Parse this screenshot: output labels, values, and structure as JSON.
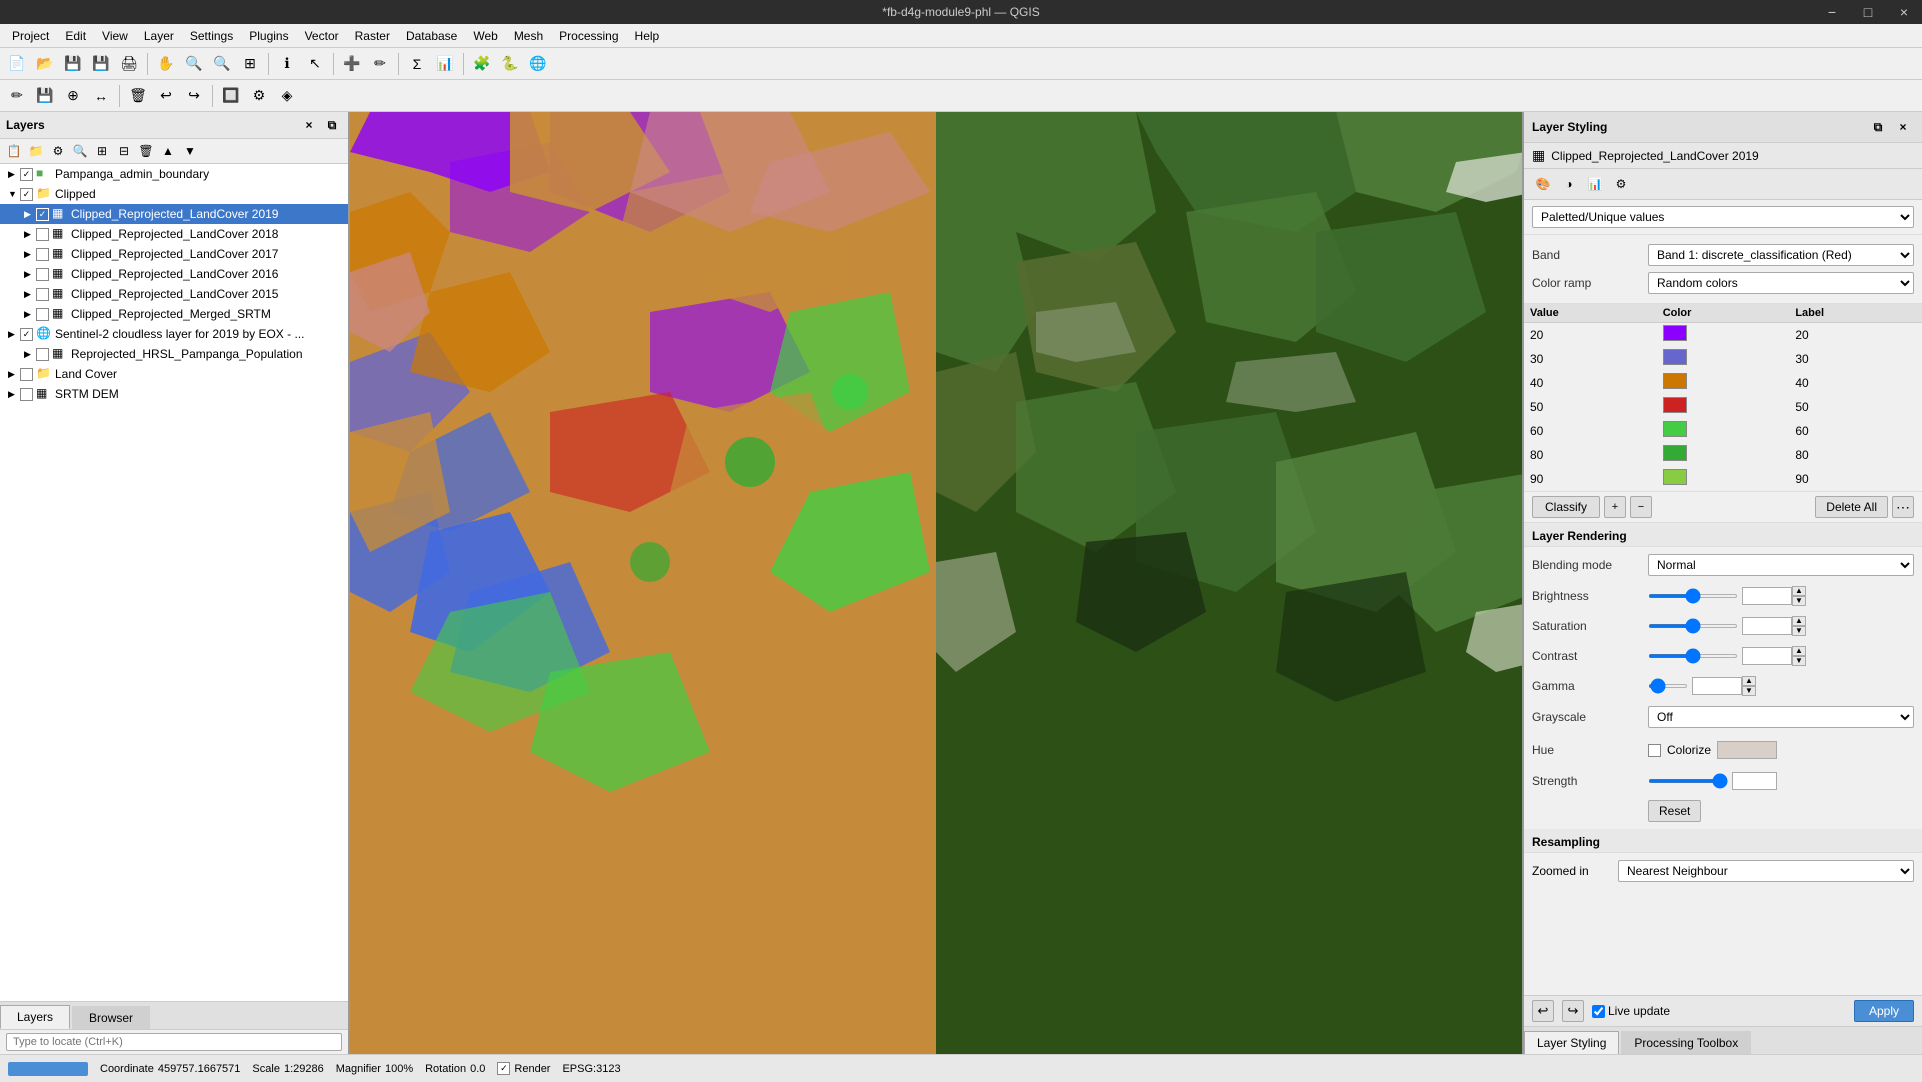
{
  "titlebar": {
    "title": "*fb-d4g-module9-phl — QGIS",
    "minimize": "−",
    "maximize": "□",
    "close": "×"
  },
  "menubar": {
    "items": [
      "Project",
      "Edit",
      "View",
      "Layer",
      "Settings",
      "Plugins",
      "Vector",
      "Raster",
      "Database",
      "Web",
      "Mesh",
      "Processing",
      "Help"
    ]
  },
  "layers_panel": {
    "title": "Layers",
    "items": [
      {
        "label": "Pampanga_admin_boundary",
        "level": 0,
        "checked": true,
        "type": "vector"
      },
      {
        "label": "Clipped",
        "level": 0,
        "checked": true,
        "type": "group",
        "expanded": true
      },
      {
        "label": "Clipped_Reprojected_LandCover 2019",
        "level": 1,
        "checked": true,
        "type": "raster",
        "selected": true
      },
      {
        "label": "Clipped_Reprojected_LandCover 2018",
        "level": 1,
        "checked": false,
        "type": "raster"
      },
      {
        "label": "Clipped_Reprojected_LandCover 2017",
        "level": 1,
        "checked": false,
        "type": "raster"
      },
      {
        "label": "Clipped_Reprojected_LandCover 2016",
        "level": 1,
        "checked": false,
        "type": "raster"
      },
      {
        "label": "Clipped_Reprojected_LandCover 2015",
        "level": 1,
        "checked": false,
        "type": "raster"
      },
      {
        "label": "Clipped_Reprojected_Merged_SRTM",
        "level": 1,
        "checked": false,
        "type": "raster"
      },
      {
        "label": "Sentinel-2 cloudless layer for 2019 by EOX - ...",
        "level": 0,
        "checked": true,
        "type": "wms"
      },
      {
        "label": "Reprojected_HRSL_Pampanga_Population",
        "level": 1,
        "checked": false,
        "type": "raster"
      },
      {
        "label": "Land Cover",
        "level": 0,
        "checked": false,
        "type": "group"
      },
      {
        "label": "SRTM DEM",
        "level": 0,
        "checked": false,
        "type": "raster"
      }
    ],
    "search_placeholder": "Type to locate (Ctrl+K)"
  },
  "map": {
    "coordinate": "459757.1667571",
    "scale": "1:29286",
    "magnifier": "100%",
    "rotation": "0.0",
    "crs": "EPSG:3123"
  },
  "layer_styling": {
    "header": "Layer Styling",
    "layer_name": "Clipped_Reprojected_LandCover 2019",
    "renderer": "Paletted/Unique values",
    "band": "Band 1: discrete_classification (Red)",
    "color_ramp": "Random colors",
    "columns": [
      "Value",
      "Color",
      "Label"
    ],
    "rows": [
      {
        "value": "20",
        "color": "#8B00FF",
        "label": "20"
      },
      {
        "value": "30",
        "color": "#6666CC",
        "label": "30"
      },
      {
        "value": "40",
        "color": "#CC7700",
        "label": "40"
      },
      {
        "value": "50",
        "color": "#CC2222",
        "label": "50"
      },
      {
        "value": "60",
        "color": "#44CC44",
        "label": "60"
      },
      {
        "value": "80",
        "color": "#33AA33",
        "label": "80"
      },
      {
        "value": "90",
        "color": "#88CC44",
        "label": "90"
      }
    ],
    "classify_label": "Classify",
    "delete_all_label": "Delete All",
    "rendering": {
      "section_title": "Layer Rendering",
      "blending_mode_label": "Blending mode",
      "blending_mode_value": "Normal",
      "brightness_label": "Brightness",
      "brightness_value": "0",
      "saturation_label": "Saturation",
      "saturation_value": "0",
      "contrast_label": "Contrast",
      "contrast_value": "0",
      "gamma_label": "Gamma",
      "gamma_value": "1.00",
      "grayscale_label": "Grayscale",
      "grayscale_value": "Off",
      "hue_label": "Hue",
      "colorize_label": "Colorize",
      "strength_label": "Strength",
      "strength_value": "100%",
      "reset_label": "Reset"
    },
    "resampling": {
      "section_title": "Resampling",
      "zoomed_in_label": "Zoomed in",
      "zoomed_in_value": "Nearest Neighbour"
    },
    "live_update_label": "Live update",
    "apply_label": "Apply",
    "tabs": [
      {
        "label": "Layer Styling",
        "active": true
      },
      {
        "label": "Processing Toolbox",
        "active": false
      }
    ]
  },
  "bottom_tabs": [
    {
      "label": "Layers",
      "active": true
    },
    {
      "label": "Browser",
      "active": false
    }
  ],
  "statusbar": {
    "coordinate_label": "Coordinate",
    "scale_label": "Scale",
    "magnifier_label": "Magnifier",
    "rotation_label": "Rotation",
    "render_label": "Render",
    "crs_label": "EPSG:3123"
  }
}
